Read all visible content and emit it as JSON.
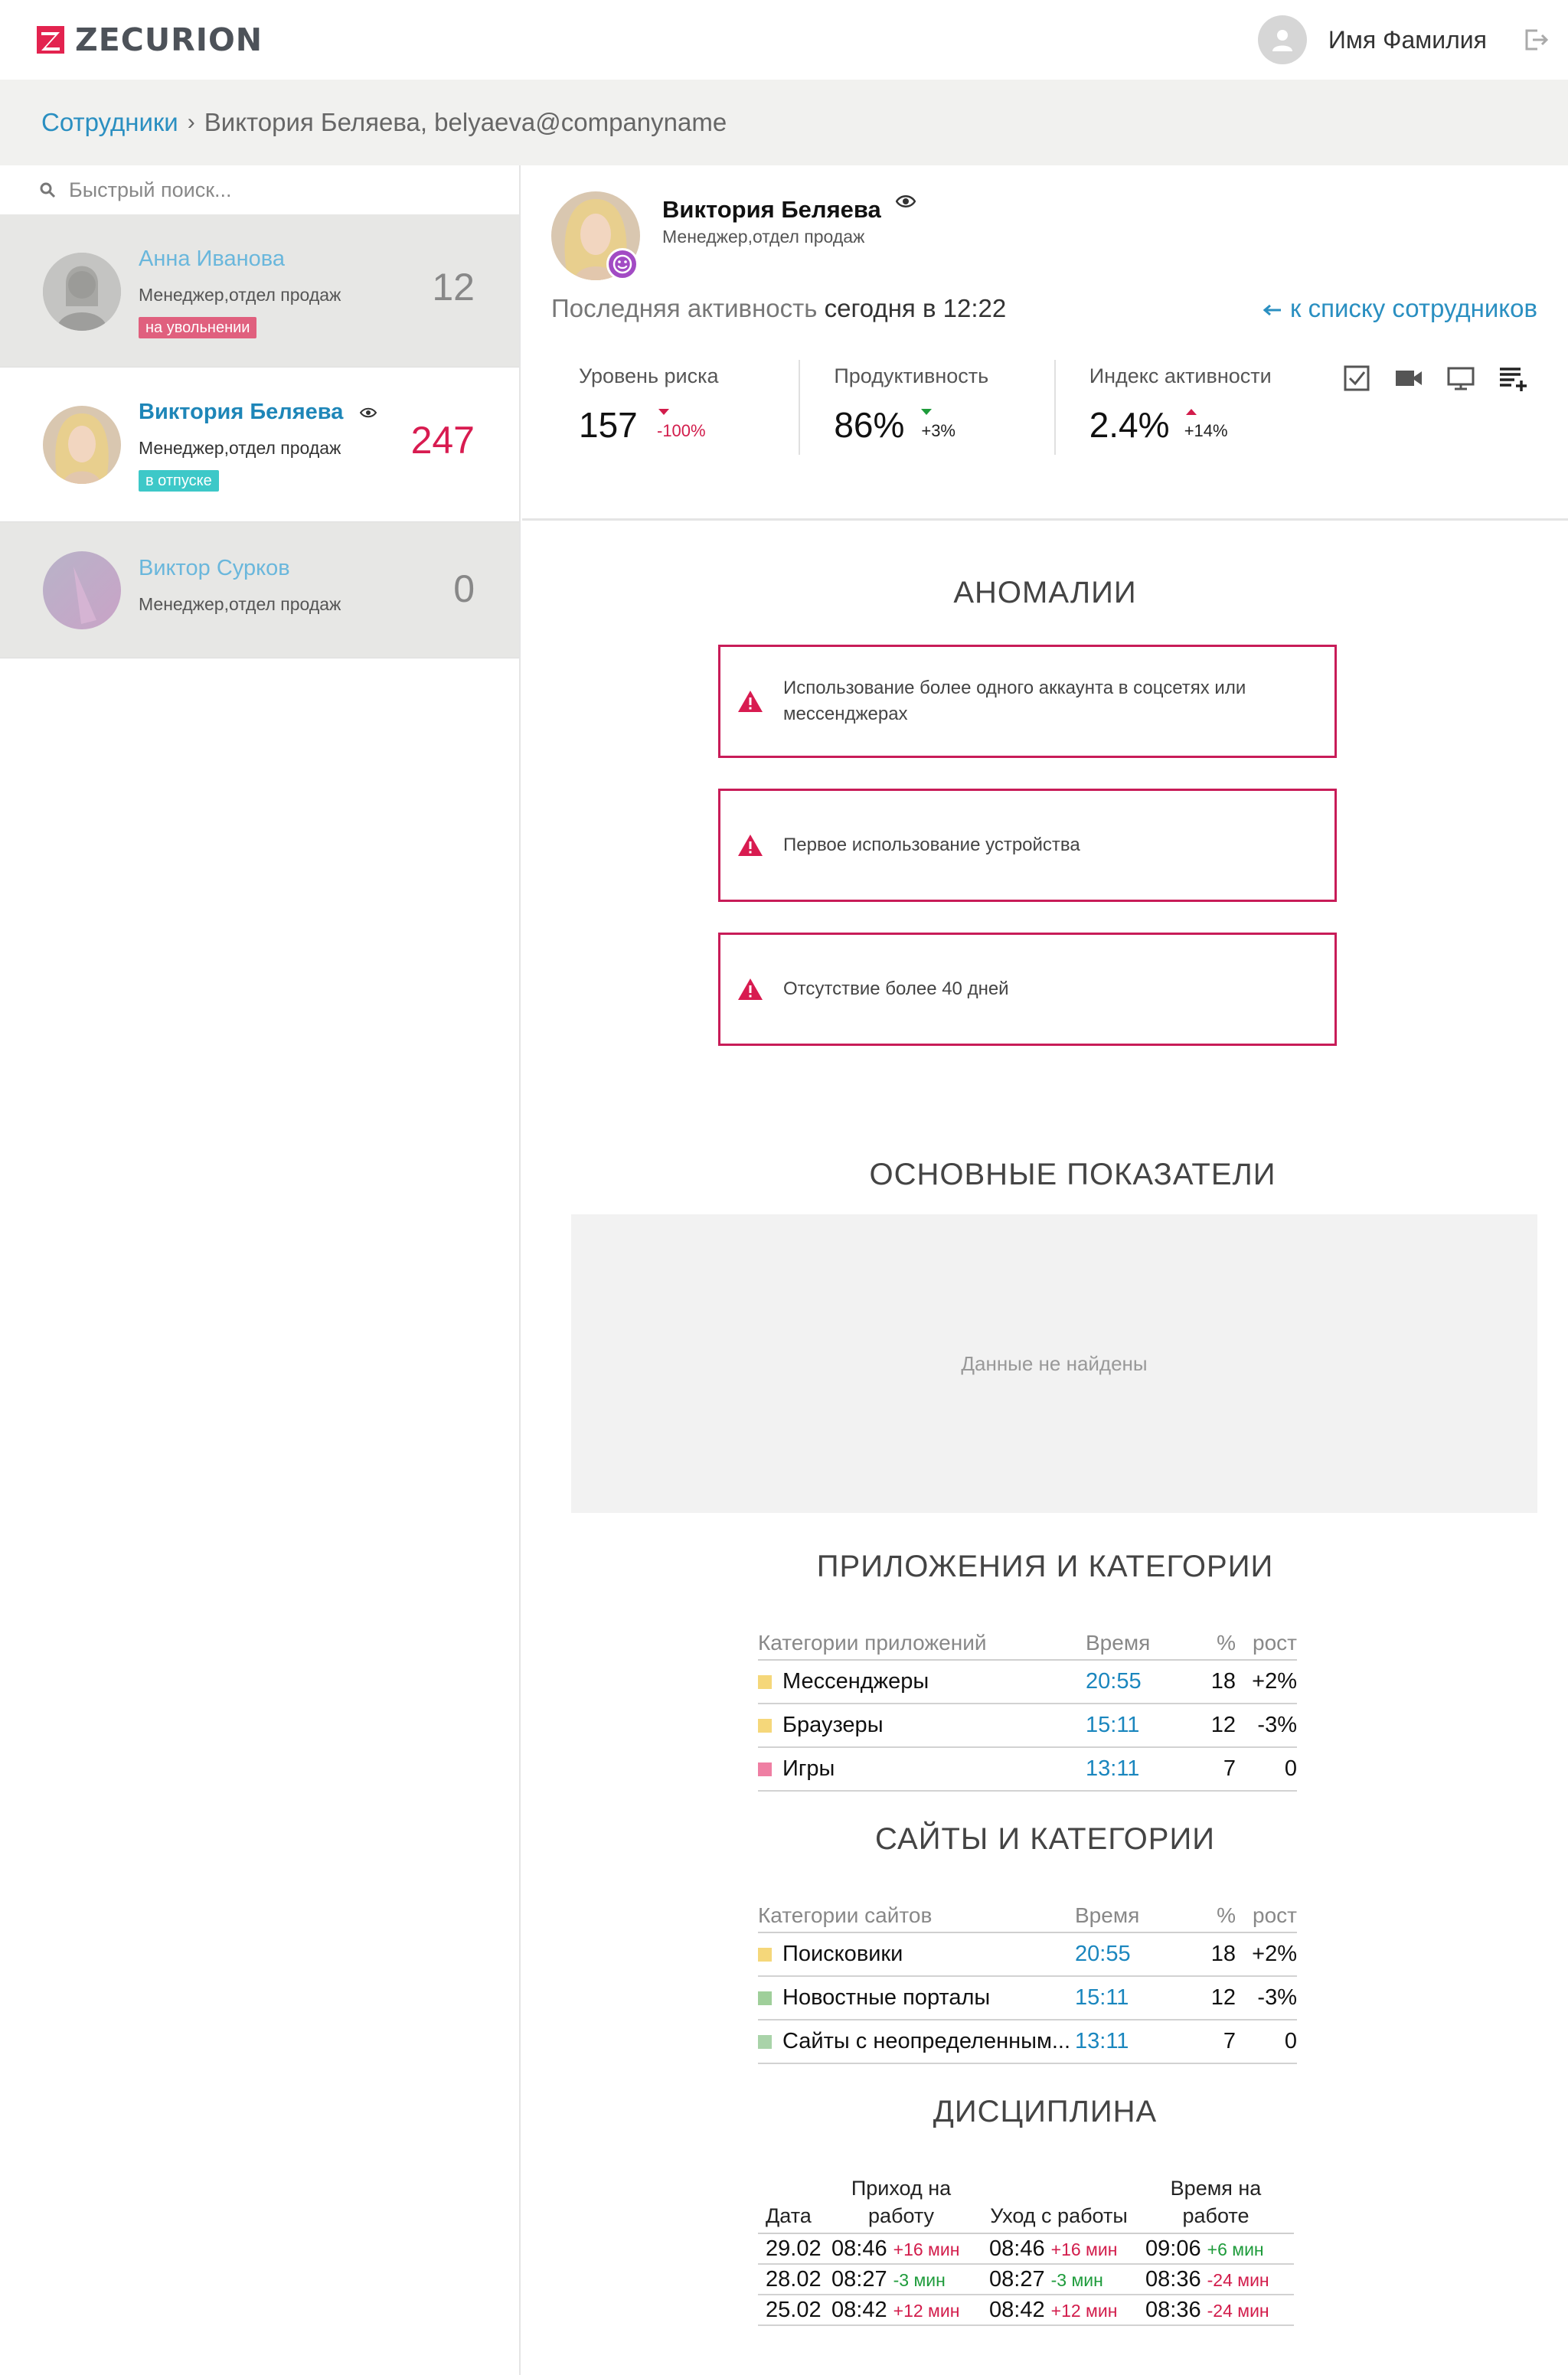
{
  "header": {
    "logo_text": "ZECURION",
    "user_name": "Имя Фамилия"
  },
  "breadcrumb": {
    "root": "Сотрудники",
    "current": "Виктория Беляева, belyaeva@companyname"
  },
  "sidebar": {
    "search_placeholder": "Быстрый поиск...",
    "employees": [
      {
        "name": "Анна Иванова",
        "role": "Менеджер,отдел продаж",
        "badge": "на увольнении",
        "badge_color": "#e0607e",
        "count": "12",
        "count_color": "#888888",
        "state": "dim"
      },
      {
        "name": "Виктория Беляева",
        "role": "Менеджер,отдел продаж",
        "badge": "в отпуске",
        "badge_color": "#3dc8c8",
        "count": "247",
        "count_color": "#d81b50",
        "state": "active",
        "eye": true
      },
      {
        "name": "Виктор Сурков",
        "role": "Менеджер,отдел продаж",
        "badge": "",
        "count": "0",
        "count_color": "#888888",
        "state": "dim"
      }
    ]
  },
  "profile": {
    "name": "Виктория Беляева",
    "role": "Менеджер,отдел продаж",
    "last_activity_label": "Последняя активность",
    "last_activity_value": "сегодня в 12:22",
    "back_link": "к списку сотрудников",
    "metrics": [
      {
        "label": "Уровень риска",
        "value": "157",
        "delta": "-100%",
        "delta_color": "#d21c4b",
        "direction": "down"
      },
      {
        "label": "Продуктивность",
        "value": "86%",
        "delta": "+3%",
        "delta_color": "#222222",
        "direction": "down-green"
      },
      {
        "label": "Индекс активности",
        "value": "2.4%",
        "delta": "+14%",
        "delta_color": "#222222",
        "direction": "up"
      }
    ]
  },
  "anomalies": {
    "title": "АНОМАЛИИ",
    "items": [
      "Использование более одного аккаунта в соцсетях или мессенджерах",
      "Первое использование устройства",
      "Отсутствие более 40 дней"
    ]
  },
  "main_indicators": {
    "title": "ОСНОВНЫЕ ПОКАЗАТЕЛИ",
    "empty_text": "Данные не найдены"
  },
  "apps": {
    "title": "ПРИЛОЖЕНИЯ И КАТЕГОРИИ",
    "headers": [
      "Категории приложений",
      "Время",
      "%",
      "рост"
    ],
    "rows": [
      {
        "color": "#f5d77a",
        "name": "Мессенджеры",
        "time": "20:55",
        "pct": "18",
        "growth": "+2%"
      },
      {
        "color": "#f5d77a",
        "name": "Браузеры",
        "time": "15:11",
        "pct": "12",
        "growth": "-3%"
      },
      {
        "color": "#ef7fa3",
        "name": "Игры",
        "time": "13:11",
        "pct": "7",
        "growth": "0"
      }
    ]
  },
  "sites": {
    "title": "САЙТЫ И КАТЕГОРИИ",
    "headers": [
      "Категории сайтов",
      "Время",
      "%",
      "рост"
    ],
    "rows": [
      {
        "color": "#f5d77a",
        "name": "Поисковики",
        "time": "20:55",
        "pct": "18",
        "growth": "+2%"
      },
      {
        "color": "#9fcf9a",
        "name": "Новостные порталы",
        "time": "15:11",
        "pct": "12",
        "growth": "-3%"
      },
      {
        "color": "#a9d3a9",
        "name": "Сайты с неопределенным...",
        "time": "13:11",
        "pct": "7",
        "growth": "0"
      }
    ]
  },
  "discipline": {
    "title": "ДИСЦИПЛИНА",
    "headers": [
      "Дата",
      "Приход на работу",
      "Уход с работы",
      "Время на работе"
    ],
    "rows": [
      {
        "date": "29.02",
        "in": "08:46",
        "in_d": "+16 мин",
        "out": "08:46",
        "out_d": "+16 мин",
        "dur": "09:06",
        "dur_d": "+6 мин"
      },
      {
        "date": "28.02",
        "in": "08:27",
        "in_d": "-3 мин",
        "out": "08:27",
        "out_d": "-3 мин",
        "dur": "08:36",
        "dur_d": "-24 мин"
      },
      {
        "date": "25.02",
        "in": "08:42",
        "in_d": "+12 мин",
        "out": "08:42",
        "out_d": "+12 мин",
        "dur": "08:36",
        "dur_d": "-24 мин"
      }
    ]
  }
}
